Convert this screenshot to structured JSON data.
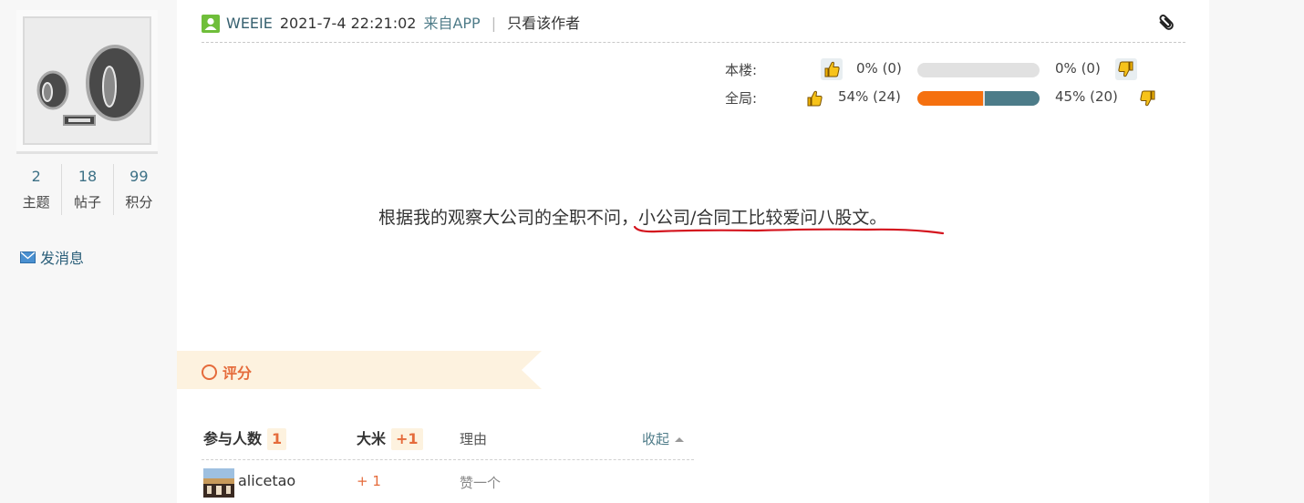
{
  "author_panel": {
    "stats": [
      {
        "value": "2",
        "label": "主题"
      },
      {
        "value": "18",
        "label": "帖子"
      },
      {
        "value": "99",
        "label": "积分"
      }
    ],
    "send_message": "发消息"
  },
  "post": {
    "author": "WEEIE",
    "datetime": "2021-7-4 22:21:02",
    "source": "来自APP",
    "separator": "|",
    "only_author": "只看该作者",
    "message": "根据我的观察大公司的全职不问，小公司/合同工比较爱问八股文。"
  },
  "votes": {
    "floor": {
      "label": "本楼:",
      "up_pct": "0% (0)",
      "down_pct": "0% (0)",
      "up_fraction": 0,
      "down_fraction": 0
    },
    "global": {
      "label": "全局:",
      "up_pct": "54% (24)",
      "down_pct": "45% (20)",
      "up_fraction": 0.54,
      "down_fraction": 0.45
    }
  },
  "rating": {
    "title": "评分",
    "headers": {
      "participants": "参与人数",
      "participants_count": "1",
      "dami": "大米",
      "dami_total": "+1",
      "reason": "理由",
      "collapse": "收起"
    },
    "rows": [
      {
        "user": "alicetao",
        "score": "+ 1",
        "reason": "赞一个"
      }
    ]
  },
  "colors": {
    "link": "#36606f",
    "up_bar": "#f5700f",
    "down_bar": "#4d7c89",
    "accent": "#e56b3b",
    "annotation": "#d4141e"
  },
  "icons": [
    "online-status-icon",
    "paperclip-icon",
    "thumbs-up-icon",
    "thumbs-down-icon",
    "mail-icon",
    "caret-up-icon"
  ]
}
